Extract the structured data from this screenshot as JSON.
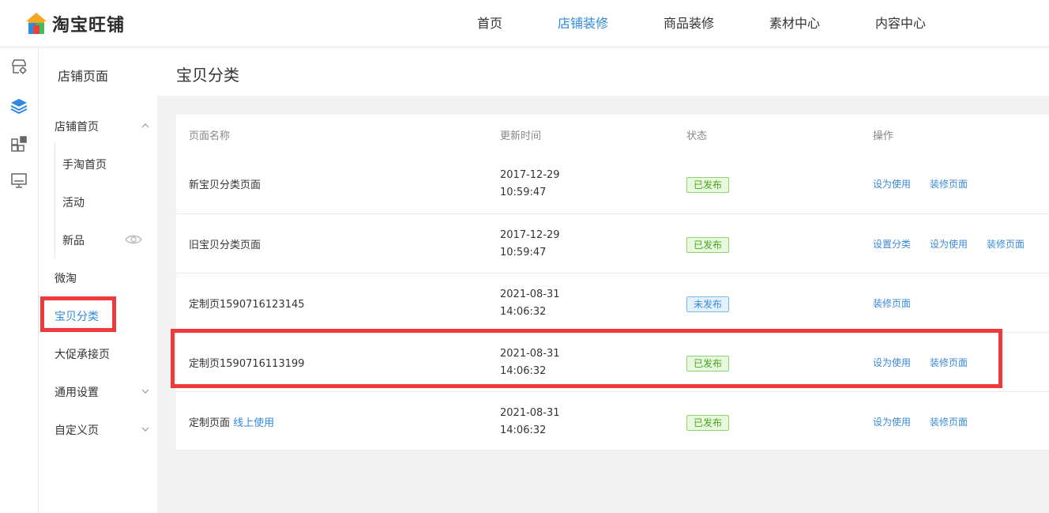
{
  "app": {
    "logo_text": "淘宝旺铺"
  },
  "top_nav": [
    {
      "label": "首页",
      "active": false
    },
    {
      "label": "店铺装修",
      "active": true
    },
    {
      "label": "商品装修",
      "active": false
    },
    {
      "label": "素材中心",
      "active": false
    },
    {
      "label": "内容中心",
      "active": false
    }
  ],
  "rail": [
    {
      "icon": "store-settings-icon"
    },
    {
      "icon": "layers-icon",
      "active": true
    },
    {
      "icon": "modules-icon"
    },
    {
      "icon": "monitor-icon"
    }
  ],
  "sidebar": {
    "title": "店铺页面",
    "items": [
      {
        "label": "店铺首页",
        "expanded": true
      },
      {
        "label": "手淘首页"
      },
      {
        "label": "活动"
      },
      {
        "label": "新品"
      },
      {
        "label": "微淘"
      },
      {
        "label": "宝贝分类",
        "active": true
      },
      {
        "label": "大促承接页"
      },
      {
        "label": "通用设置"
      },
      {
        "label": "自定义页"
      }
    ]
  },
  "main": {
    "title": "宝贝分类",
    "columns": [
      "页面名称",
      "更新时间",
      "状态",
      "操作"
    ],
    "rows": [
      {
        "name": "新宝贝分类页面",
        "name_link": "",
        "date": "2017-12-29",
        "time": "10:59:47",
        "status": "已发布",
        "ops": [
          "设为使用",
          "装修页面"
        ]
      },
      {
        "name": "旧宝贝分类页面",
        "name_link": "",
        "date": "2017-12-29",
        "time": "10:59:47",
        "status": "已发布",
        "ops": [
          "设置分类",
          "设为使用",
          "装修页面"
        ]
      },
      {
        "name": "定制页1590716123145",
        "name_link": "",
        "date": "2021-08-31",
        "time": "14:06:32",
        "status": "未发布",
        "ops": [
          "装修页面"
        ]
      },
      {
        "name": "定制页1590716113199",
        "name_link": "",
        "date": "2021-08-31",
        "time": "14:06:32",
        "status": "已发布",
        "ops": [
          "设为使用",
          "装修页面"
        ]
      },
      {
        "name": "定制页面",
        "name_link": "线上使用",
        "date": "2021-08-31",
        "time": "14:06:32",
        "status": "已发布",
        "ops": [
          "设为使用",
          "装修页面"
        ]
      }
    ]
  },
  "colors": {
    "accent": "#3089dc",
    "highlight": "#ee3a3a",
    "published": "#4aa51f",
    "unpublished": "#3b8ad6"
  }
}
